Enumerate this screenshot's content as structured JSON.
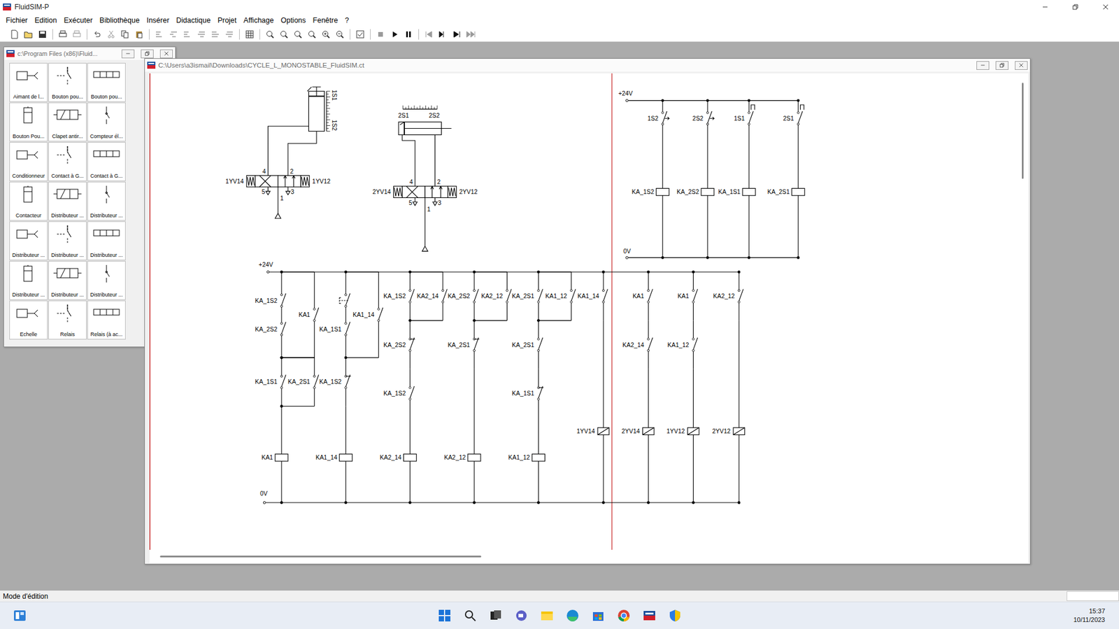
{
  "app": {
    "title": "FluidSIM-P"
  },
  "menu": [
    "Fichier",
    "Edition",
    "Exécuter",
    "Bibliothèque",
    "Insérer",
    "Didactique",
    "Projet",
    "Affichage",
    "Options",
    "Fenêtre",
    "?"
  ],
  "library": {
    "title": "c:\\Program Files (x86)\\Fluid...",
    "items": [
      "Aimant de l...",
      "Bouton pou...",
      "Bouton pou...",
      "Bouton Pou...",
      "Clapet antir...",
      "Compteur él...",
      "Conditionneur",
      "Contact à G...",
      "Contact à G...",
      "Contacteur",
      "Distributeur ...",
      "Distributeur ...",
      "Distributeur ...",
      "Distributeur ...",
      "Distributeur ...",
      "Distributeur ...",
      "Distributeur ...",
      "Distributeur ...",
      "Echelle",
      "Relais",
      "Relais (à ac..."
    ]
  },
  "document": {
    "title": "C:\\Users\\a3ismail\\Downloads\\CYCLE_L_MONOSTABLE_FluidSIM.ct"
  },
  "pneumatics": [
    {
      "cylinder": "1",
      "kind": "vertical",
      "sensors": [
        "1S1",
        "1S2"
      ],
      "valve": {
        "solenoid_left": "1YV14",
        "solenoid_right": "1YV12",
        "port_a": "4",
        "port_b": "2",
        "exhaust_a": "5",
        "supply": "1",
        "exhaust_b": "3"
      }
    },
    {
      "cylinder": "2",
      "kind": "horizontal",
      "sensors": [
        "2S1",
        "2S2"
      ],
      "valve": {
        "solenoid_left": "2YV14",
        "solenoid_right": "2YV12",
        "port_a": "4",
        "port_b": "2",
        "exhaust_a": "5",
        "supply": "1",
        "exhaust_b": "3"
      }
    }
  ],
  "sensor_circuit": {
    "supply": "+24V",
    "ground": "0V",
    "branches": [
      {
        "contact": "1S2",
        "kind": "magnetic",
        "coil": "KA_1S2"
      },
      {
        "contact": "2S2",
        "kind": "magnetic",
        "coil": "KA_2S2"
      },
      {
        "contact": "1S1",
        "kind": "roller",
        "coil": "KA_1S1"
      },
      {
        "contact": "2S1",
        "kind": "roller",
        "coil": "KA_2S1"
      }
    ]
  },
  "control_circuit": {
    "supply": "+24V",
    "ground": "0V",
    "rungs": [
      {
        "segments": [
          [
            [
              {
                "label": "KA_1S2",
                "kind": "no"
              },
              {
                "label": "KA_2S2",
                "kind": "no"
              }
            ],
            [
              {
                "label": "KA1",
                "kind": "no"
              }
            ]
          ],
          [
            [
              {
                "label": "KA_1S1",
                "kind": "no"
              }
            ],
            [
              {
                "label": "KA_2S1",
                "kind": "no"
              }
            ]
          ]
        ],
        "coil": {
          "label": "KA1",
          "kind": "relay"
        }
      },
      {
        "segments": [
          [
            [
              {
                "kind": "button"
              },
              {
                "label": "KA_1S1",
                "kind": "no"
              }
            ],
            [
              {
                "label": "KA1_14",
                "kind": "no"
              }
            ]
          ],
          [
            [
              {
                "label": "KA_1S2",
                "kind": "nc"
              }
            ]
          ]
        ],
        "coil": {
          "label": "KA1_14",
          "kind": "relay"
        }
      },
      {
        "segments": [
          [
            [
              {
                "label": "KA_1S2",
                "kind": "no"
              }
            ],
            [
              {
                "label": "KA2_14",
                "kind": "no"
              }
            ]
          ],
          [
            [
              {
                "label": "KA_2S2",
                "kind": "nc"
              }
            ]
          ],
          [
            [
              {
                "label": "KA_1S2",
                "kind": "no"
              }
            ]
          ]
        ],
        "coil": {
          "label": "KA2_14",
          "kind": "relay"
        }
      },
      {
        "segments": [
          [
            [
              {
                "label": "KA_2S2",
                "kind": "no"
              }
            ],
            [
              {
                "label": "KA2_12",
                "kind": "no"
              }
            ]
          ],
          [
            [
              {
                "label": "KA_2S1",
                "kind": "nc"
              }
            ]
          ]
        ],
        "coil": {
          "label": "KA2_12",
          "kind": "relay"
        }
      },
      {
        "segments": [
          [
            [
              {
                "label": "KA_2S1",
                "kind": "no"
              }
            ],
            [
              {
                "label": "KA1_12",
                "kind": "no"
              }
            ]
          ],
          [
            [
              {
                "label": "KA_2S1",
                "kind": "no"
              }
            ]
          ],
          [
            [
              {
                "label": "KA_1S1",
                "kind": "nc"
              }
            ]
          ]
        ],
        "coil": {
          "label": "KA1_12",
          "kind": "relay"
        }
      },
      {
        "segments": [
          [
            [
              {
                "label": "KA1_14",
                "kind": "no"
              }
            ]
          ]
        ],
        "coil": {
          "label": "1YV14",
          "kind": "solenoid"
        }
      },
      {
        "segments": [
          [
            [
              {
                "label": "KA1",
                "kind": "no"
              }
            ]
          ],
          [
            [
              {
                "label": "KA2_14",
                "kind": "no"
              }
            ]
          ]
        ],
        "coil": {
          "label": "2YV14",
          "kind": "solenoid"
        }
      },
      {
        "segments": [
          [
            [
              {
                "label": "KA1",
                "kind": "no"
              }
            ]
          ],
          [
            [
              {
                "label": "KA1_12",
                "kind": "no"
              }
            ]
          ]
        ],
        "coil": {
          "label": "1YV12",
          "kind": "solenoid"
        }
      },
      {
        "segments": [
          [
            [
              {
                "label": "KA2_12",
                "kind": "no"
              }
            ]
          ]
        ],
        "coil": {
          "label": "2YV12",
          "kind": "solenoid"
        }
      }
    ]
  },
  "status_bar": "Mode d'édition",
  "taskbar": {
    "time": "15:37",
    "date": "10/11/2023"
  }
}
